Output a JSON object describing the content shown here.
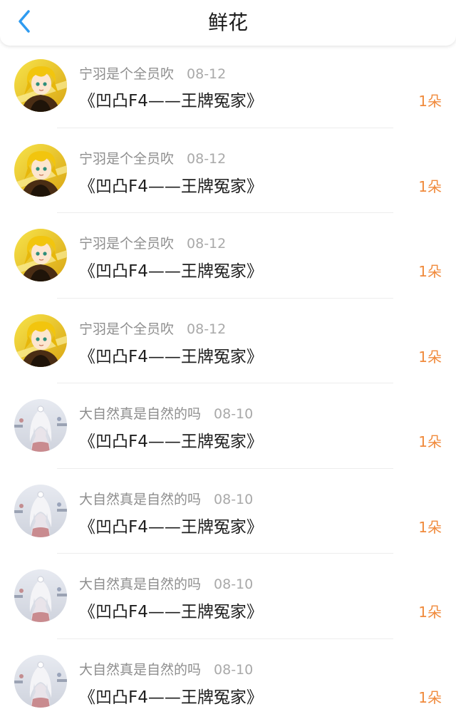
{
  "header": {
    "title": "鲜花",
    "back_icon": "chevron-left-icon",
    "accent_color": "#2f9bf0"
  },
  "colors": {
    "count_color": "#f08a3c"
  },
  "items": [
    {
      "user": "宁羽是个全员吹",
      "date": "08-12",
      "book": "《凹凸F4——王牌冤家》",
      "count": "1朵",
      "avatar": "avatar-blonde"
    },
    {
      "user": "宁羽是个全员吹",
      "date": "08-12",
      "book": "《凹凸F4——王牌冤家》",
      "count": "1朵",
      "avatar": "avatar-blonde"
    },
    {
      "user": "宁羽是个全员吹",
      "date": "08-12",
      "book": "《凹凸F4——王牌冤家》",
      "count": "1朵",
      "avatar": "avatar-blonde"
    },
    {
      "user": "宁羽是个全员吹",
      "date": "08-12",
      "book": "《凹凸F4——王牌冤家》",
      "count": "1朵",
      "avatar": "avatar-blonde"
    },
    {
      "user": "大自然真是自然的吗",
      "date": "08-10",
      "book": "《凹凸F4——王牌冤家》",
      "count": "1朵",
      "avatar": "avatar-silver"
    },
    {
      "user": "大自然真是自然的吗",
      "date": "08-10",
      "book": "《凹凸F4——王牌冤家》",
      "count": "1朵",
      "avatar": "avatar-silver"
    },
    {
      "user": "大自然真是自然的吗",
      "date": "08-10",
      "book": "《凹凸F4——王牌冤家》",
      "count": "1朵",
      "avatar": "avatar-silver"
    },
    {
      "user": "大自然真是自然的吗",
      "date": "08-10",
      "book": "《凹凸F4——王牌冤家》",
      "count": "1朵",
      "avatar": "avatar-silver"
    }
  ]
}
